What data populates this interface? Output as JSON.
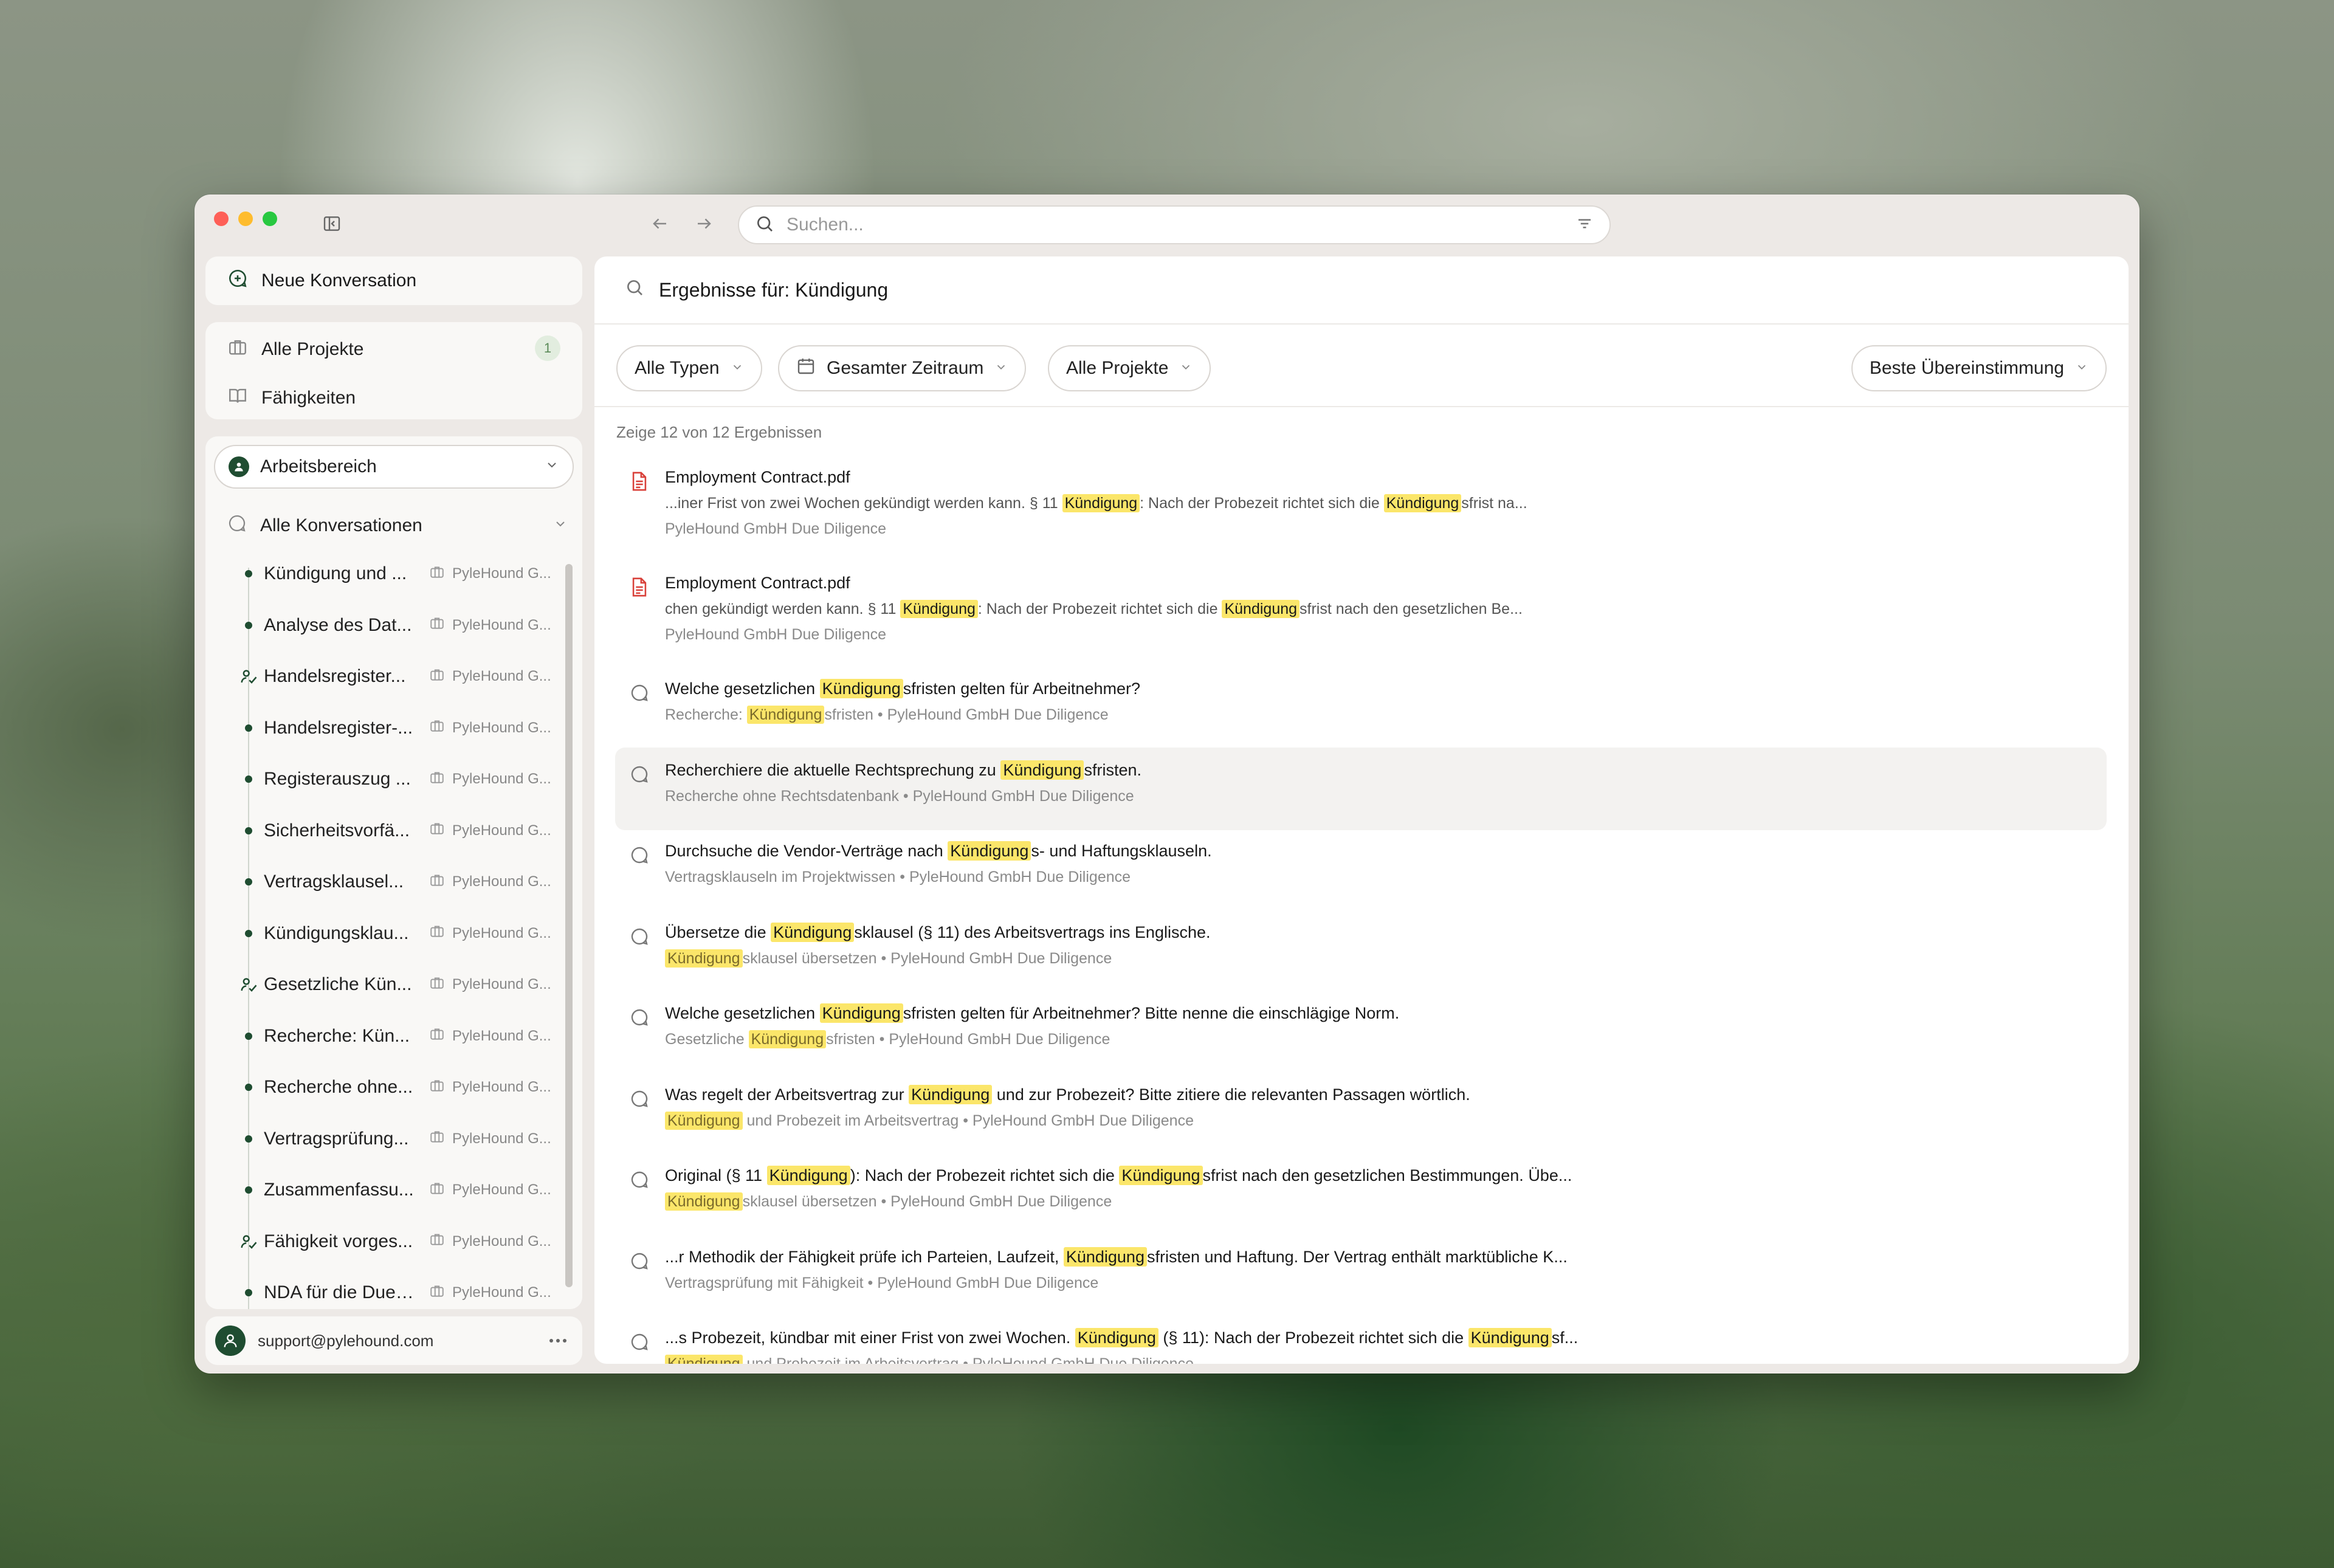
{
  "search": {
    "placeholder": "Suchen..."
  },
  "sidebar": {
    "new_conversation": "Neue Konversation",
    "nav": [
      {
        "label": "Alle Projekte",
        "badge": "1"
      },
      {
        "label": "Fähigkeiten"
      }
    ],
    "workspace": "Arbeitsbereich",
    "all_conversations": "Alle Konversationen",
    "conversations": [
      {
        "title": "Kündigung und ...",
        "project": "PyleHound G...",
        "marker": "dot"
      },
      {
        "title": "Analyse des Dat...",
        "project": "PyleHound G...",
        "marker": "dot"
      },
      {
        "title": "Handelsregister...",
        "project": "PyleHound G...",
        "marker": "skill"
      },
      {
        "title": "Handelsregister-...",
        "project": "PyleHound G...",
        "marker": "dot"
      },
      {
        "title": "Registerauszug ...",
        "project": "PyleHound G...",
        "marker": "dot"
      },
      {
        "title": "Sicherheitsvorfä...",
        "project": "PyleHound G...",
        "marker": "dot"
      },
      {
        "title": "Vertragsklausel...",
        "project": "PyleHound G...",
        "marker": "dot"
      },
      {
        "title": "Kündigungsklau...",
        "project": "PyleHound G...",
        "marker": "dot"
      },
      {
        "title": "Gesetzliche Kün...",
        "project": "PyleHound G...",
        "marker": "skill"
      },
      {
        "title": "Recherche: Kün...",
        "project": "PyleHound G...",
        "marker": "dot"
      },
      {
        "title": "Recherche ohne...",
        "project": "PyleHound G...",
        "marker": "dot"
      },
      {
        "title": "Vertragsprüfung...",
        "project": "PyleHound G...",
        "marker": "dot"
      },
      {
        "title": "Zusammenfassu...",
        "project": "PyleHound G...",
        "marker": "dot"
      },
      {
        "title": "Fähigkeit vorges...",
        "project": "PyleHound G...",
        "marker": "skill"
      },
      {
        "title": "NDA für die Due ...",
        "project": "PyleHound G...",
        "marker": "dot"
      }
    ],
    "user_email": "support@pylehound.com"
  },
  "main": {
    "results_heading": "Ergebnisse für: Kündigung",
    "filters": {
      "type": "Alle Typen",
      "time": "Gesamter Zeitraum",
      "projects": "Alle Projekte",
      "sort": "Beste Übereinstimmung"
    },
    "count_text": "Zeige 12 von 12 Ergebnissen",
    "results": [
      {
        "kind": "document",
        "title": "Employment Contract.pdf",
        "line": [
          "...iner Frist von zwei Wochen gekündigt werden kann. § 11 ",
          "Kündigung",
          ": Nach der Probezeit richtet sich die ",
          "Kündigung",
          "sfrist na..."
        ],
        "sub": [
          "PyleHound GmbH Due Diligence"
        ]
      },
      {
        "kind": "document",
        "title": "Employment Contract.pdf",
        "line": [
          "chen gekündigt werden kann. § 11 ",
          "Kündigung",
          ": Nach der Probezeit richtet sich die ",
          "Kündigung",
          "sfrist nach den gesetzlichen Be..."
        ],
        "sub": [
          "PyleHound GmbH Due Diligence"
        ]
      },
      {
        "kind": "chat",
        "title_parts": [
          "Welche gesetzlichen ",
          "Kündigung",
          "sfristen gelten für Arbeitnehmer?"
        ],
        "sub": [
          "Recherche: ",
          "Kündigung",
          "sfristen • PyleHound GmbH Due Diligence"
        ]
      },
      {
        "kind": "chat",
        "title_parts": [
          "Recherchiere die aktuelle Rechtsprechung zu ",
          "Kündigung",
          "sfristen."
        ],
        "sub": [
          "Recherche ohne Rechtsdatenbank • PyleHound GmbH Due Diligence"
        ]
      },
      {
        "kind": "chat",
        "title_parts": [
          "Durchsuche die Vendor-Verträge nach ",
          "Kündigung",
          "s- und Haftungsklauseln."
        ],
        "sub": [
          "Vertragsklauseln im Projektwissen • PyleHound GmbH Due Diligence"
        ]
      },
      {
        "kind": "chat",
        "title_parts": [
          "Übersetze die ",
          "Kündigung",
          "sklausel (§ 11) des Arbeitsvertrags ins Englische."
        ],
        "sub": [
          "",
          "Kündigung",
          "sklausel übersetzen • PyleHound GmbH Due Diligence"
        ]
      },
      {
        "kind": "chat",
        "title_parts": [
          "Welche gesetzlichen ",
          "Kündigung",
          "sfristen gelten für Arbeitnehmer? Bitte nenne die einschlägige Norm."
        ],
        "sub": [
          "Gesetzliche ",
          "Kündigung",
          "sfristen • PyleHound GmbH Due Diligence"
        ]
      },
      {
        "kind": "chat",
        "title_parts": [
          "Was regelt der Arbeitsvertrag zur ",
          "Kündigung",
          " und zur Probezeit? Bitte zitiere die relevanten Passagen wörtlich."
        ],
        "sub": [
          "",
          "Kündigung",
          " und Probezeit im Arbeitsvertrag • PyleHound GmbH Due Diligence"
        ]
      },
      {
        "kind": "chat",
        "title_parts": [
          "Original (§ 11 ",
          "Kündigung",
          "): Nach der Probezeit richtet sich die ",
          "Kündigung",
          "sfrist nach den gesetzlichen Bestimmungen. Übe..."
        ],
        "sub": [
          "",
          "Kündigung",
          "sklausel übersetzen • PyleHound GmbH Due Diligence"
        ]
      },
      {
        "kind": "chat",
        "title_parts": [
          "...r Methodik der Fähigkeit prüfe ich Parteien, Laufzeit, ",
          "Kündigung",
          "sfristen und Haftung. Der Vertrag enthält marktübliche K..."
        ],
        "sub": [
          "Vertragsprüfung mit Fähigkeit • PyleHound GmbH Due Diligence"
        ]
      },
      {
        "kind": "chat",
        "title_parts": [
          "...s Probezeit, kündbar mit einer Frist von zwei Wochen. ",
          "Kündigung",
          " (§ 11): Nach der Probezeit richtet sich die ",
          "Kündigung",
          "sf..."
        ],
        "sub": [
          "",
          "Kündigung",
          " und Probezeit im Arbeitsvertrag • PyleHound GmbH Due Diligence"
        ]
      }
    ]
  },
  "colors": {
    "accent_green": "#1f4d31",
    "highlight_yellow": "#fbe66a",
    "pdf_red": "#d9413a"
  }
}
